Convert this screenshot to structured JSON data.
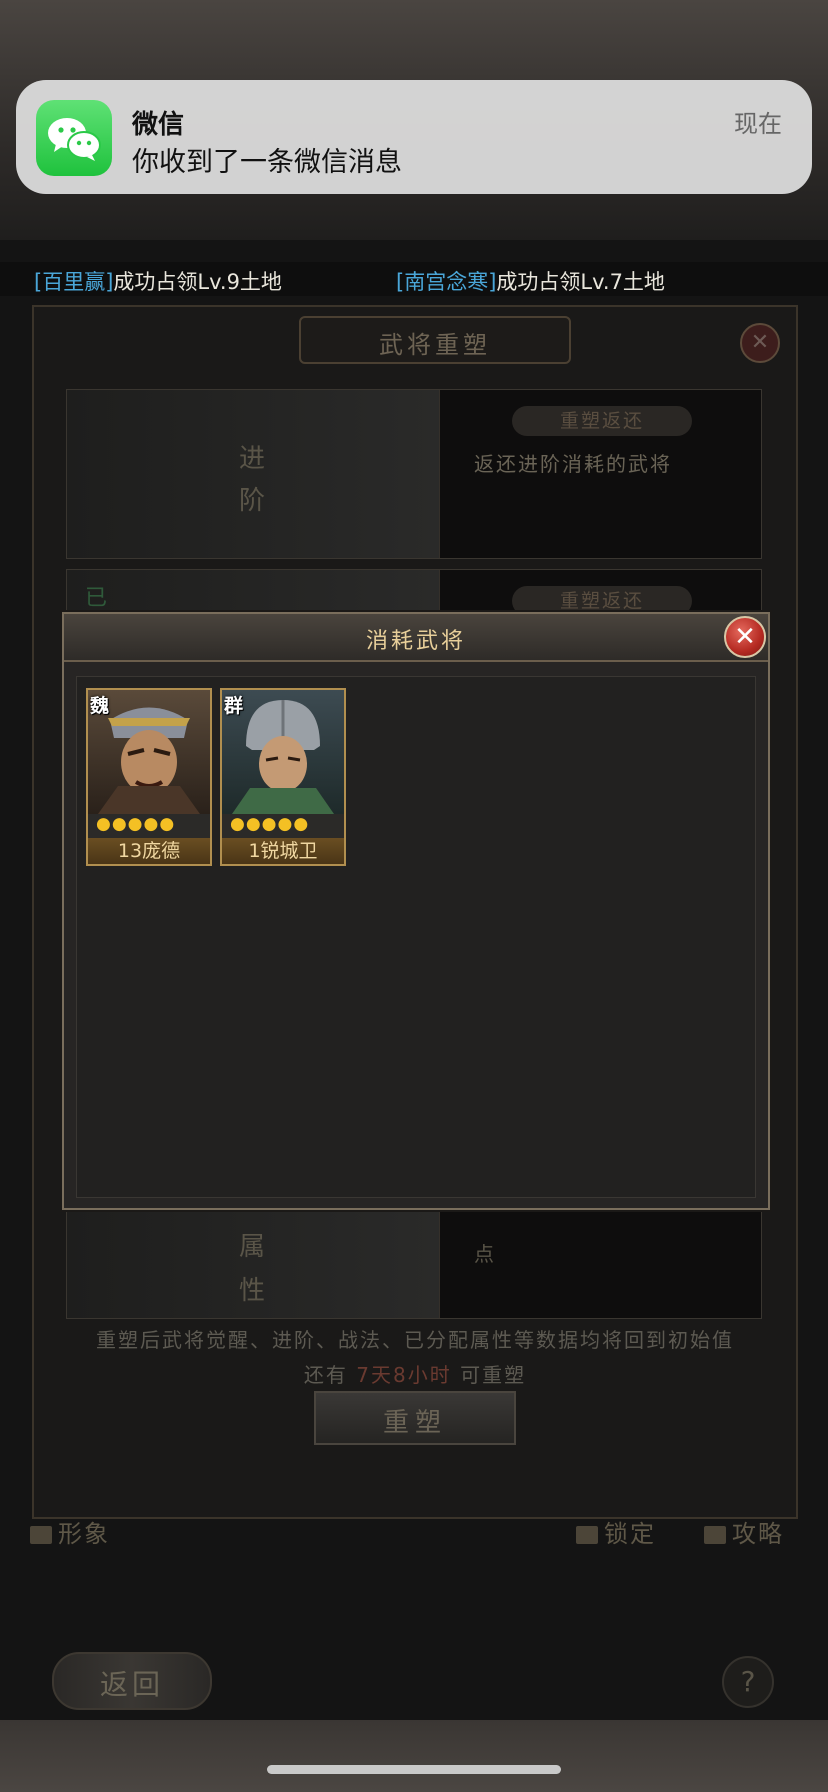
{
  "notification": {
    "app_name": "微信",
    "message": "你收到了一条微信消息",
    "time": "现在"
  },
  "ticker": [
    {
      "name": "[百里赢]",
      "text": "成功占领Lv.9土地"
    },
    {
      "name": "[南宫念寒]",
      "text": "成功占领Lv.7土地"
    }
  ],
  "main_dialog": {
    "title": "武将重塑",
    "rows": [
      {
        "left_label_1": "进",
        "left_label_2": "阶",
        "pill": "重塑返还",
        "desc": "返还进阶消耗的武将"
      },
      {
        "left_label_1": "已",
        "left_label_2": "",
        "pill": "重塑返还",
        "desc": ""
      },
      {
        "left_label_1": "属",
        "left_label_2": "性",
        "pill": "",
        "desc": "点"
      }
    ],
    "reset_description": "重塑后武将觉醒、进阶、战法、已分配属性等数据均将回到初始值",
    "remaining_prefix": "还有 ",
    "remaining_time": "7天8小时",
    "remaining_suffix": " 可重塑",
    "reset_button": "重塑"
  },
  "bottom_bar": {
    "image_label": "形象",
    "lock_label": "锁定",
    "guide_label": "攻略"
  },
  "back_button": "返回",
  "help_button": "?",
  "popup": {
    "title": "消耗武将",
    "close": "✕",
    "cards": [
      {
        "faction": "魏",
        "stars": "●●●●●",
        "level_name": "13庞德",
        "color": "#b5862e"
      },
      {
        "faction": "群",
        "stars": "●●●●●",
        "level_name": "1锐城卫",
        "color": "#6a7a6a"
      }
    ]
  }
}
